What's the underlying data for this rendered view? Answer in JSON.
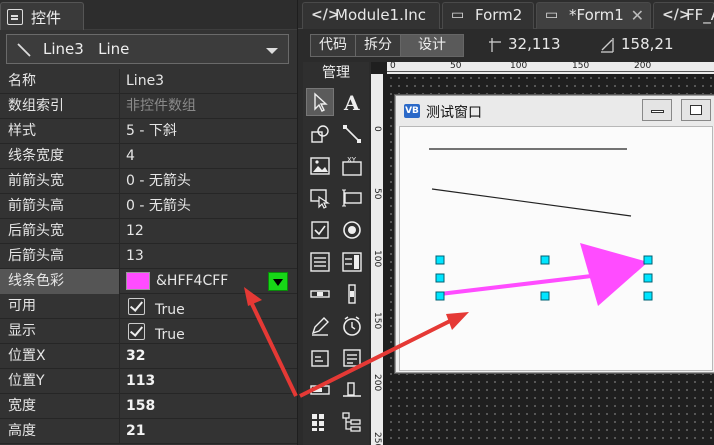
{
  "left_panel": {
    "tab_label": "控件",
    "object_selector": "Line3   Line",
    "properties": [
      {
        "key": "名称",
        "value": "Line3"
      },
      {
        "key": "数组索引",
        "value": "非控件数组"
      },
      {
        "key": "样式",
        "value": "5 - 下斜"
      },
      {
        "key": "线条宽度",
        "value": "4"
      },
      {
        "key": "前箭头宽",
        "value": "0 - 无箭头"
      },
      {
        "key": "前箭头高",
        "value": "0 - 无箭头"
      },
      {
        "key": "后箭头宽",
        "value": "12"
      },
      {
        "key": "后箭头高",
        "value": "13"
      },
      {
        "key": "线条色彩",
        "value": "&HFF4CFF"
      },
      {
        "key": "可用",
        "value": "True"
      },
      {
        "key": "显示",
        "value": "True"
      },
      {
        "key": "位置X",
        "value": "32"
      },
      {
        "key": "位置Y",
        "value": "113"
      },
      {
        "key": "宽度",
        "value": "158"
      },
      {
        "key": "高度",
        "value": "21"
      }
    ]
  },
  "editor": {
    "tabs": [
      {
        "icon": "</>",
        "label": "Module1.Inc"
      },
      {
        "icon": "▭",
        "label": "Form2"
      },
      {
        "icon": "▭",
        "label": "*Form1"
      },
      {
        "icon": "</>",
        "label": "FF_A"
      }
    ],
    "view_modes": [
      "代码",
      "拆分",
      "设计"
    ],
    "position_readout": "32,113",
    "size_readout": "158,21",
    "toolbox_header": "管理",
    "ruler_top": [
      "0",
      "50",
      "100",
      "150",
      "200"
    ],
    "ruler_left": [
      "0",
      "50",
      "100",
      "150",
      "200",
      "250"
    ],
    "form": {
      "title": "测试窗口",
      "icon_text": "VB"
    }
  },
  "colors": {
    "line_color": "#FF4CFF",
    "selection_handle": "#00E5FF",
    "annotation_arrow": "#E53935",
    "dropdown_green": "#17D617"
  }
}
